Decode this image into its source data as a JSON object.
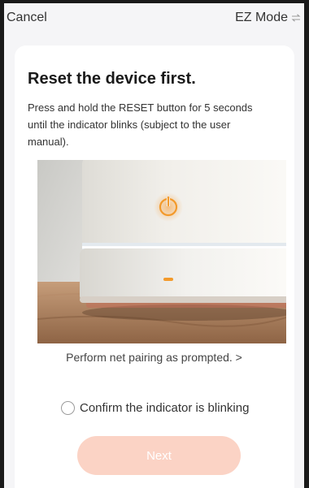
{
  "topbar": {
    "cancel_label": "Cancel",
    "mode_label": "EZ Mode",
    "mode_icon": "swap-arrows-icon"
  },
  "main": {
    "title": "Reset the device first.",
    "description": "Press and hold the RESET button for 5 seconds until the indicator blinks (subject to the user manual).",
    "image_icon": "device-reset-illustration",
    "pairing_link": "Perform net pairing as prompted. >",
    "confirm_label": "Confirm the indicator is blinking",
    "confirm_checked": false,
    "next_label": "Next"
  },
  "colors": {
    "accent": "#f8a98c",
    "next_disabled": "#fbd3c5",
    "indicator": "#f39a2b",
    "background": "#f5f5f7",
    "card": "#ffffff"
  }
}
